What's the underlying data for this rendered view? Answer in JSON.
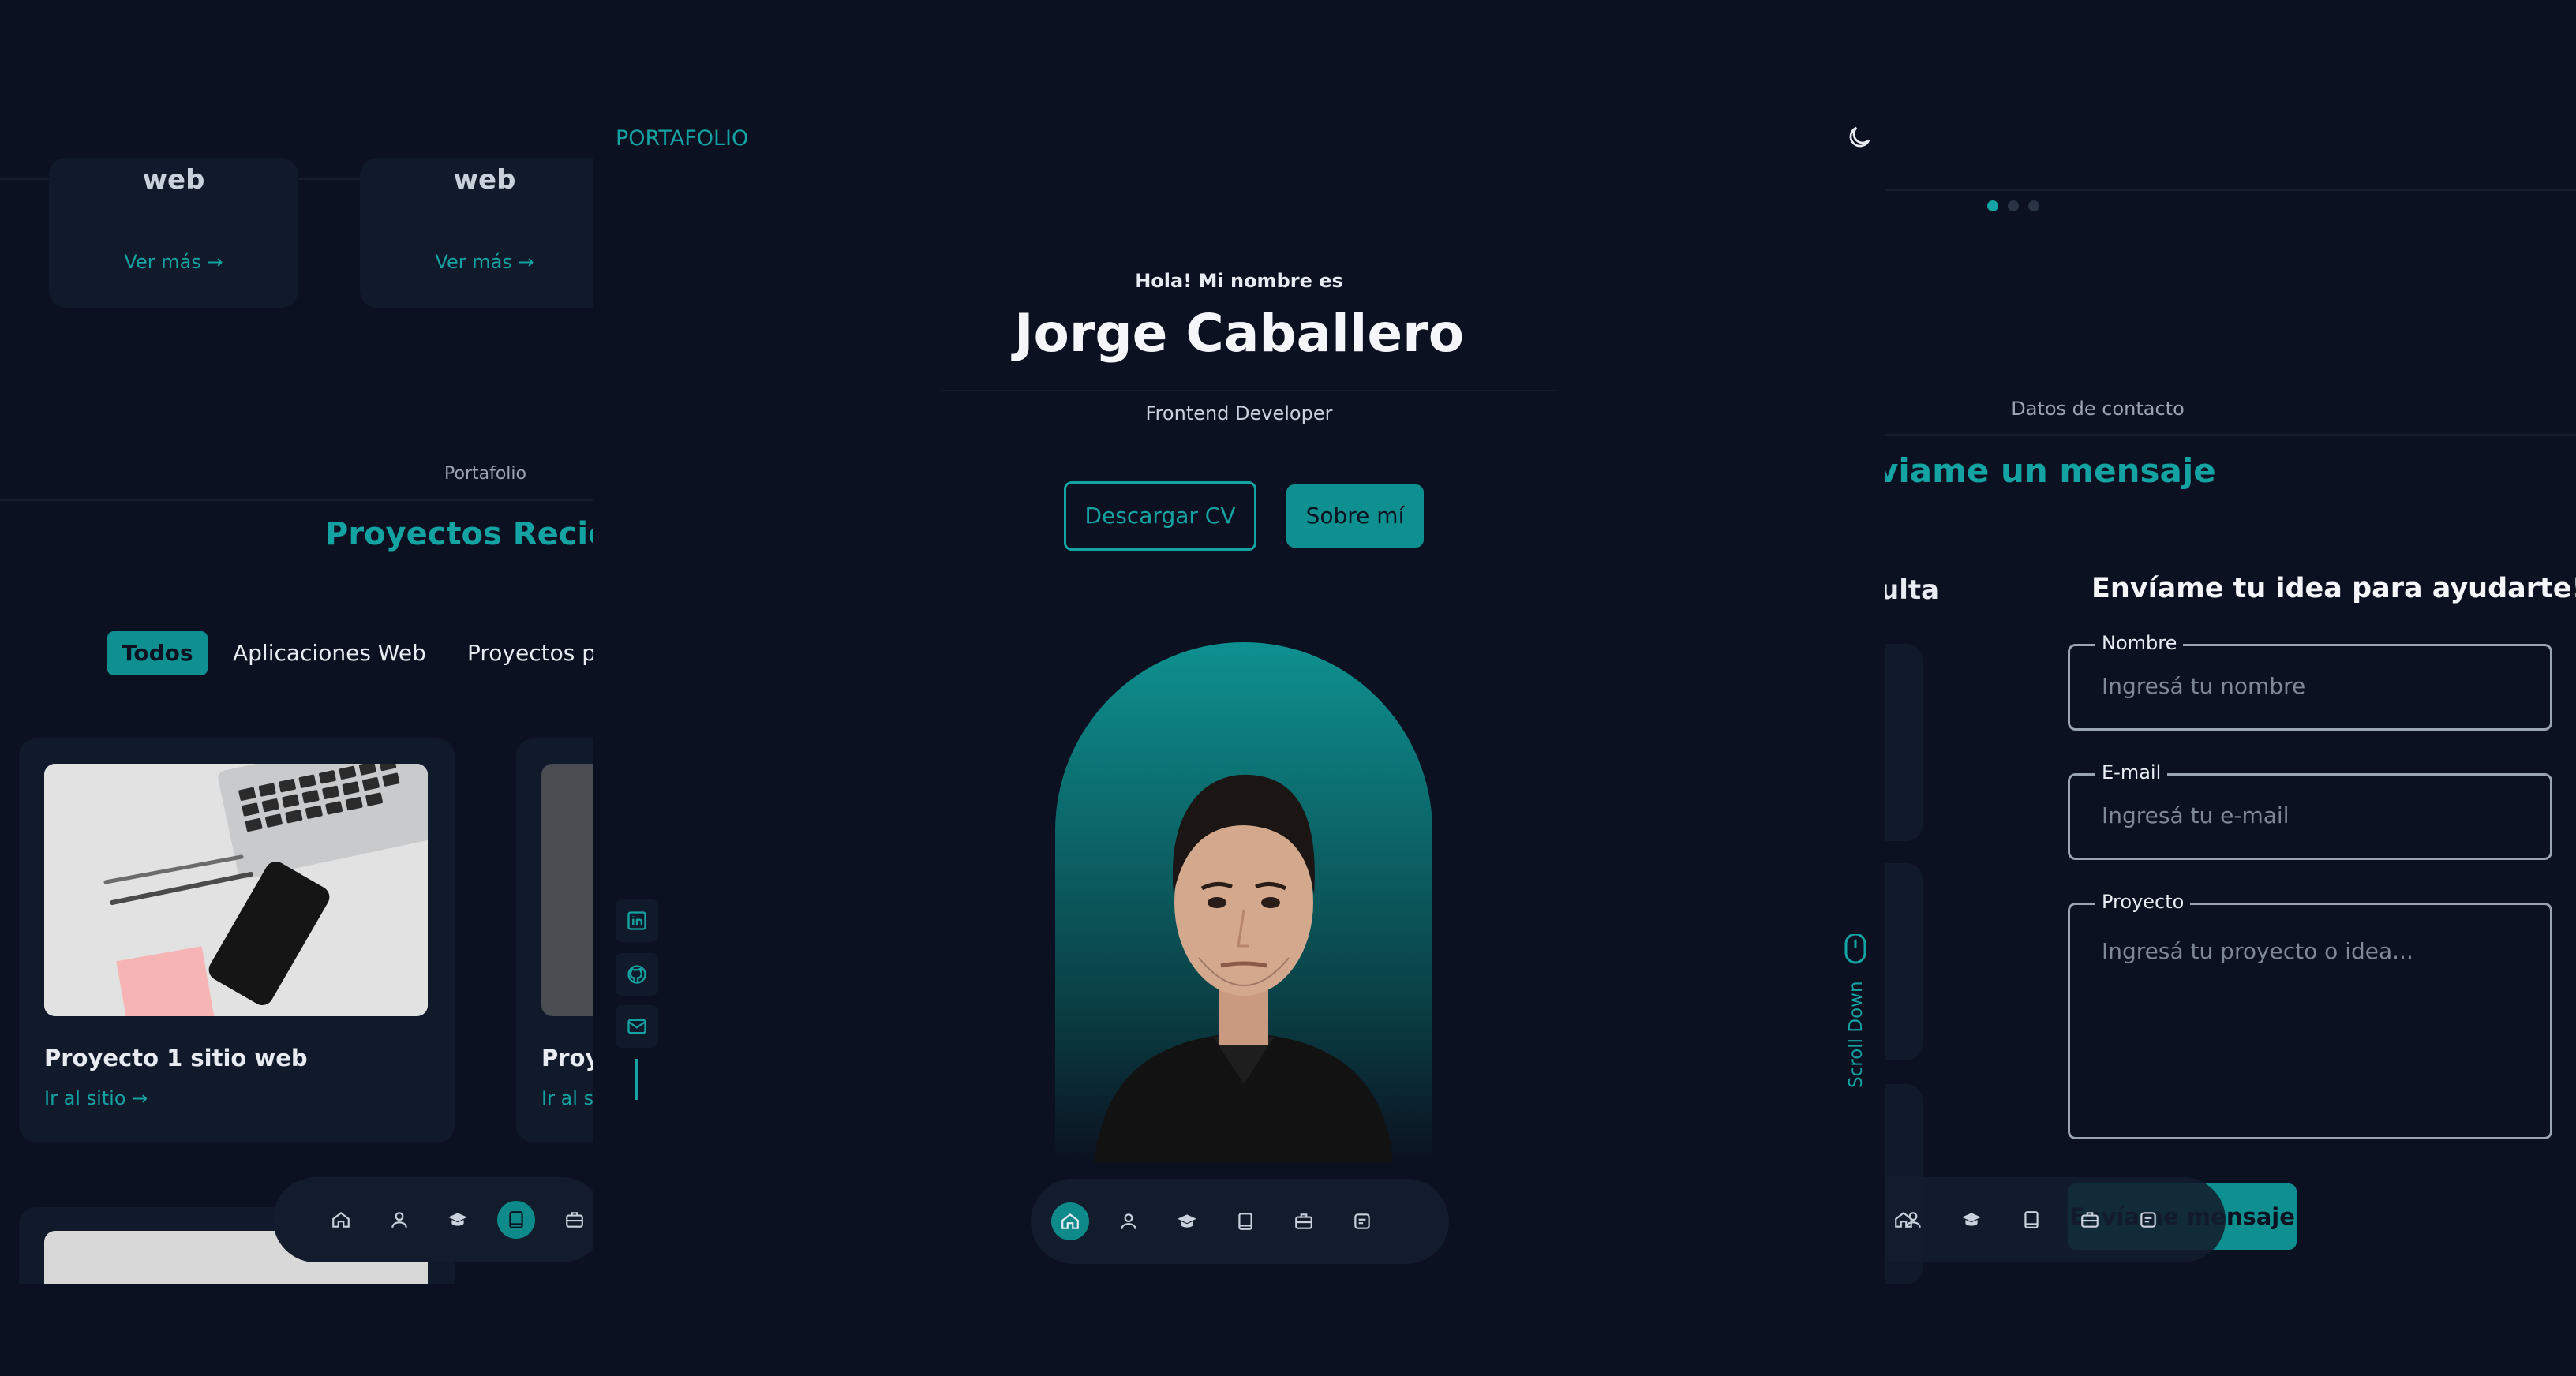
{
  "brand": "PORTAFOLIO",
  "colors": {
    "background": "#0b1120",
    "card": "#111a2a",
    "accent": "#14a3a3",
    "accent_button": "#0e9090"
  },
  "hero": {
    "greeting": "Hola! Mi nombre es",
    "name": "Jorge Caballero",
    "role": "Frontend Developer",
    "download_cv_label": "Descargar CV",
    "about_label": "Sobre mí"
  },
  "social_icons": [
    "linkedin-icon",
    "github-icon",
    "mail-icon"
  ],
  "scroll_down_label": "Scroll Down",
  "nav_icons": [
    "home-icon",
    "user-icon",
    "graduation-cap-icon",
    "book-icon",
    "briefcase-icon",
    "message-icon"
  ],
  "services": {
    "cards": [
      {
        "title": "web",
        "more_label": "Ver más"
      },
      {
        "title": "web",
        "more_label": "Ver más"
      }
    ]
  },
  "portfolio": {
    "subtitle": "Portafolio",
    "title": "Proyectos Recien",
    "filters": [
      "Todos",
      "Aplicaciones Web",
      "Proyectos pe"
    ],
    "active_filter": "Todos",
    "projects": [
      {
        "name": "Proyecto 1 sitio web",
        "link_label": "Ir al sitio"
      },
      {
        "name": "Proye",
        "link_label": "Ir al si"
      }
    ]
  },
  "contact": {
    "subtitle": "Datos de contacto",
    "title": "viame un mensaje",
    "left_heading": "ulta",
    "form_title": "Envíame tu idea para ayudarte!",
    "fields": [
      {
        "label": "Nombre",
        "placeholder": "Ingresá tu nombre"
      },
      {
        "label": "E-mail",
        "placeholder": "Ingresá tu e-mail"
      },
      {
        "label": "Proyecto",
        "placeholder": "Ingresá tu proyecto o idea..."
      }
    ],
    "send_label": "Envíame mensaje",
    "carousel_dots": 3,
    "active_dot": 1
  }
}
